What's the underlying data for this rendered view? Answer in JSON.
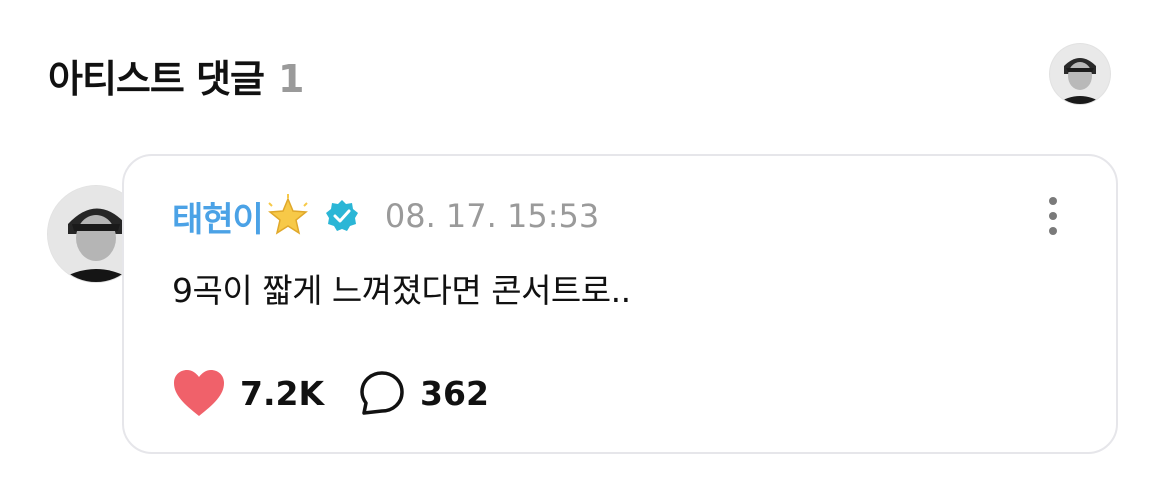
{
  "header": {
    "title": "아티스트 댓글",
    "count": "1"
  },
  "comment": {
    "username": "태현이",
    "timestamp": "08. 17. 15:53",
    "text": "9곡이 짧게 느껴졌다면 콘서트로..",
    "likes": "7.2K",
    "replies": "362"
  },
  "icons": {
    "name_emoji": "glowing-star-icon",
    "verified": "verified-badge-icon",
    "more": "more-vertical-icon",
    "like": "heart-icon",
    "reply": "speech-bubble-icon"
  },
  "colors": {
    "username": "#4ba2e6",
    "verified": "#2bb6d6",
    "heart": "#f0616a",
    "muted": "#9a9a9a",
    "card_border": "#e6e6ea"
  }
}
